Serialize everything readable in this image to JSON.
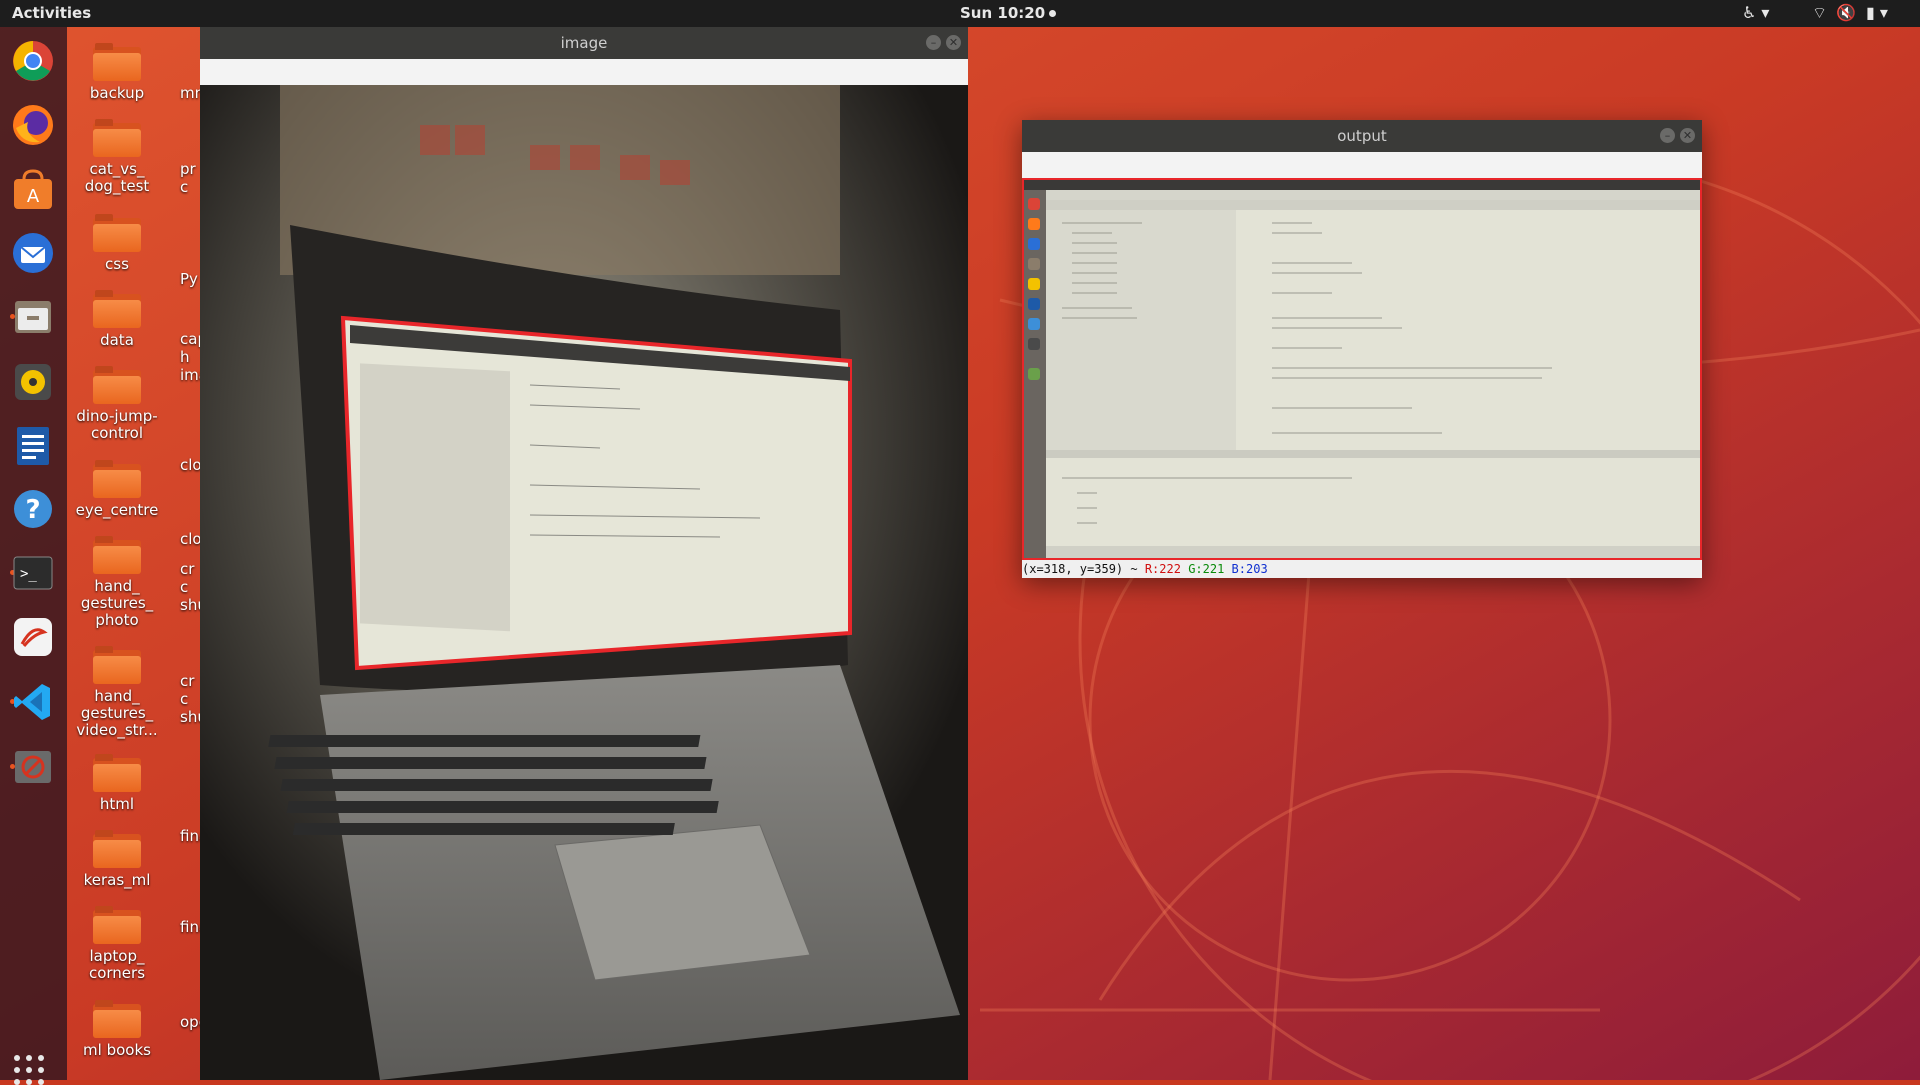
{
  "topbar": {
    "activities": "Activities",
    "clock": "Sun 10:20"
  },
  "dock": {
    "items": [
      {
        "name": "chrome-icon"
      },
      {
        "name": "firefox-icon"
      },
      {
        "name": "software-center-icon"
      },
      {
        "name": "thunderbird-icon"
      },
      {
        "name": "files-icon"
      },
      {
        "name": "rhythmbox-icon"
      },
      {
        "name": "libreoffice-writer-icon"
      },
      {
        "name": "help-icon"
      },
      {
        "name": "terminal-icon"
      },
      {
        "name": "screenshot-app-icon"
      },
      {
        "name": "vscode-icon"
      },
      {
        "name": "opencv-app-icon"
      }
    ]
  },
  "desktop": {
    "icons": [
      "backup",
      "cat_vs_\ndog_test",
      "css",
      "data",
      "dino-jump-\ncontrol",
      "eye_centre",
      "hand_\ngestures_\nphoto",
      "hand_\ngestures_\nvideo_str...",
      "html",
      "keras_ml",
      "laptop_\ncorners",
      "ml books"
    ],
    "col2": [
      "mnis",
      "pr\nc",
      "Py",
      "cap\nh\nima",
      "clos",
      "clos",
      "cr\nc\nshu",
      "cr\nc\nshu",
      "fina",
      "fina",
      "ope"
    ]
  },
  "windows": {
    "image": {
      "title": "image"
    },
    "output": {
      "title": "output",
      "status": "(x=318, y=359) ~",
      "r": "R:222",
      "g": "G:221",
      "b": "B:203"
    }
  },
  "colors": {
    "accent": "#e95420",
    "topbar": "#1d1d1d",
    "outline": "#e8262a"
  }
}
